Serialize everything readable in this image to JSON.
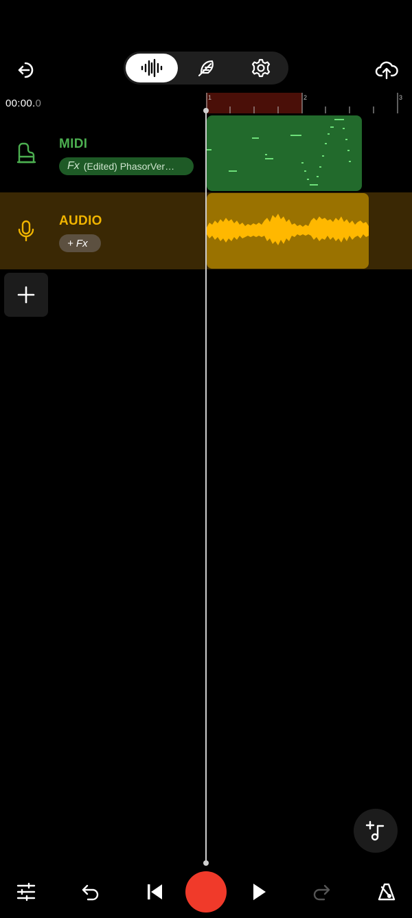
{
  "header": {
    "exit_icon": "exit-icon",
    "tabs": [
      {
        "name": "waveform-icon",
        "selected": true
      },
      {
        "name": "feather-icon",
        "selected": false
      },
      {
        "name": "gear-icon",
        "selected": false
      }
    ],
    "upload_icon": "cloud-upload-icon"
  },
  "timeline": {
    "time_main": "00:00.",
    "time_frac": "0",
    "ruler_marks": [
      "1",
      "2",
      "3"
    ]
  },
  "tracks": [
    {
      "name": "MIDI",
      "color": "#4caf50",
      "icon": "piano-icon",
      "fx_label": "Fx",
      "fx_text": "(Edited) PhasorVer…"
    },
    {
      "name": "AUDIO",
      "color": "#f0b400",
      "icon": "microphone-icon",
      "fx_label": "+ Fx"
    }
  ],
  "colors": {
    "midi_clip": "#226a2c",
    "audio_clip": "#9a7200",
    "audio_wave": "#ffb800",
    "record": "#f03a2a"
  },
  "bottom_bar": {
    "icons": [
      "mixer-sliders-icon",
      "undo-icon",
      "skip-back-icon",
      "record-button",
      "play-icon",
      "redo-icon",
      "metronome-icon"
    ]
  }
}
